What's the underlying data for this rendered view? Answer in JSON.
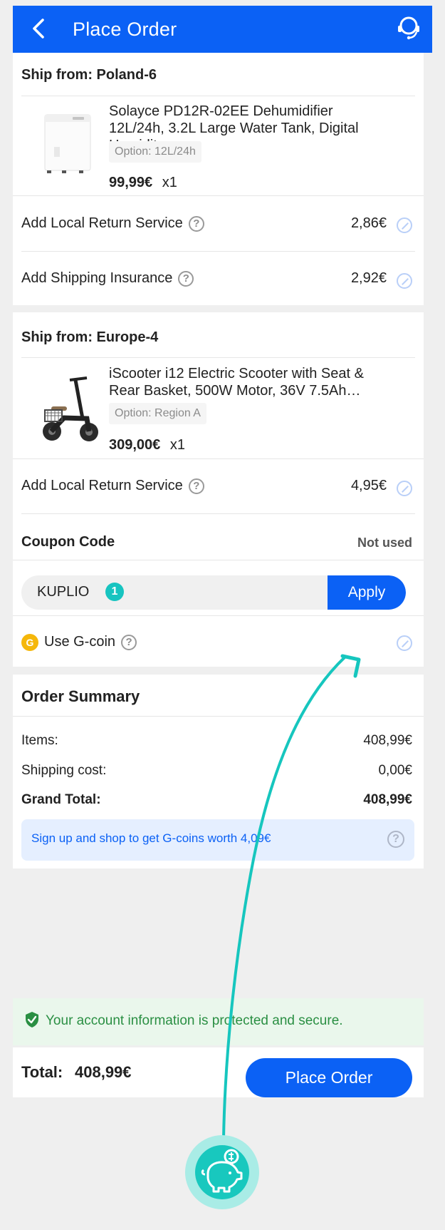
{
  "header": {
    "title": "Place Order"
  },
  "sections": [
    {
      "ship_from": "Ship from: Poland-6",
      "product": {
        "name": "Solayce PD12R-02EE Dehumidifier 12L/24h, 3.2L Large Water Tank, Digital Humidity…",
        "option": "Option: 12L/24h",
        "price": "99,99€",
        "qty": "x1"
      },
      "services": [
        {
          "label": "Add Local Return Service",
          "price": "2,86€"
        },
        {
          "label": "Add Shipping Insurance",
          "price": "2,92€"
        }
      ]
    },
    {
      "ship_from": "Ship from: Europe-4",
      "product": {
        "name": "iScooter i12 Electric Scooter with Seat & Rear Basket, 500W Motor, 36V 7.5Ah…",
        "option": "Option: Region A",
        "price": "309,00€",
        "qty": "x1"
      },
      "services": [
        {
          "label": "Add Local Return Service",
          "price": "4,95€"
        }
      ]
    }
  ],
  "coupon": {
    "title": "Coupon Code",
    "status": "Not used",
    "value": "KUPLIO",
    "badge": "1",
    "apply": "Apply"
  },
  "gcoin": {
    "label": "Use G-coin",
    "icon_text": "G"
  },
  "summary": {
    "title": "Order Summary",
    "items_label": "Items:",
    "items_value": "408,99€",
    "shipping_label": "Shipping cost:",
    "shipping_value": "0,00€",
    "grand_label": "Grand Total:",
    "grand_value": "408,99€",
    "info": "Sign up and shop to get G-coins worth 4,09€"
  },
  "security_text": "Your account information is protected and secure.",
  "footer": {
    "total_label": "Total:",
    "total_value": "408,99€",
    "place_order": "Place Order"
  },
  "colors": {
    "accent": "#0b61f5",
    "teal": "#17c4c0",
    "green": "#2a8f43"
  }
}
